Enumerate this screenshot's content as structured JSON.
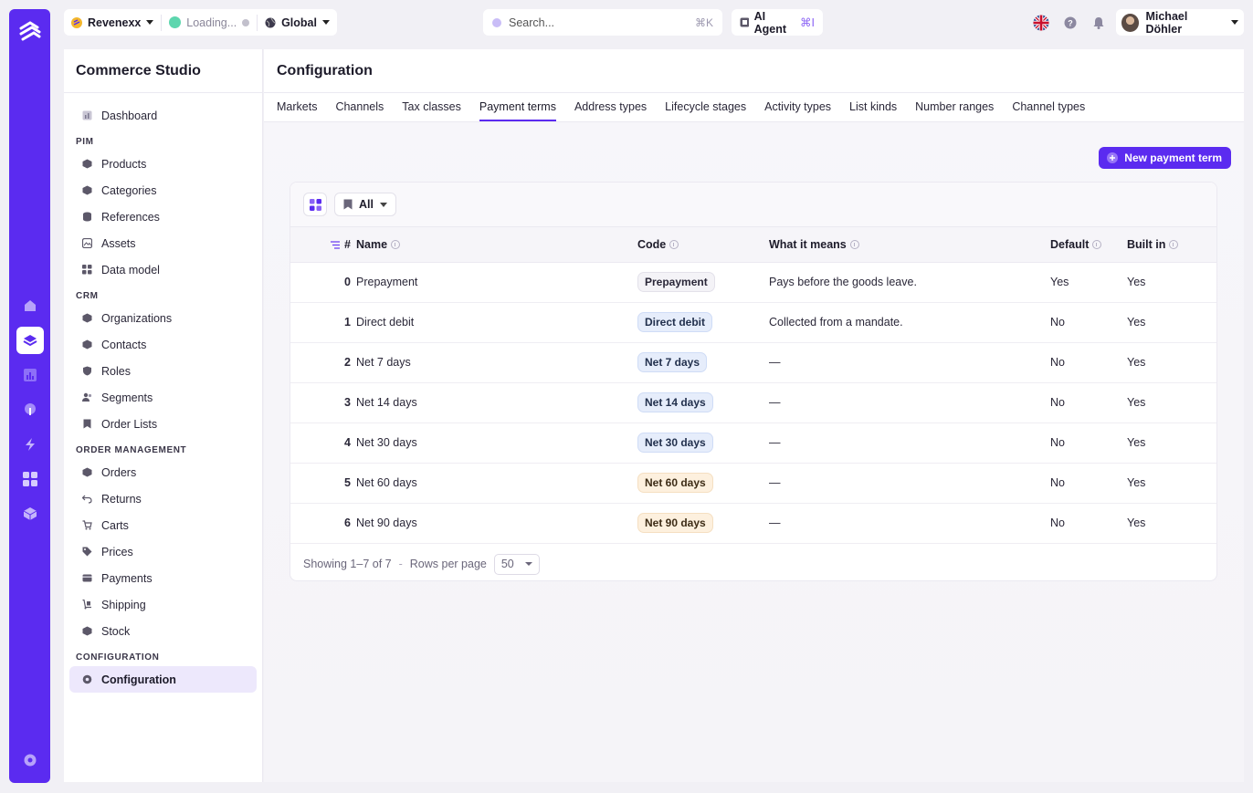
{
  "topbar": {
    "workspace": "Revenexx",
    "status": "Loading...",
    "region": "Global",
    "search_placeholder": "Search...",
    "search_shortcut": "⌘K",
    "agent_label": "AI Agent",
    "agent_shortcut": "⌘I",
    "user_name": "Michael Döhler"
  },
  "sidebar": {
    "title": "Commerce Studio",
    "dashboard": "Dashboard",
    "sections": [
      {
        "title": "PIM",
        "items": [
          "Products",
          "Categories",
          "References",
          "Assets",
          "Data model"
        ]
      },
      {
        "title": "CRM",
        "items": [
          "Organizations",
          "Contacts",
          "Roles",
          "Segments",
          "Order Lists"
        ]
      },
      {
        "title": "ORDER MANAGEMENT",
        "items": [
          "Orders",
          "Returns",
          "Carts",
          "Prices",
          "Payments",
          "Shipping",
          "Stock"
        ]
      },
      {
        "title": "CONFIGURATION",
        "items": [
          "Configuration"
        ]
      }
    ]
  },
  "page": {
    "title": "Configuration",
    "tabs": [
      "Markets",
      "Channels",
      "Tax classes",
      "Payment terms",
      "Address types",
      "Lifecycle stages",
      "Activity types",
      "List kinds",
      "Number ranges",
      "Channel types"
    ],
    "active_tab": "Payment terms",
    "new_button": "New payment term",
    "filter_label": "All"
  },
  "table": {
    "columns": {
      "index": "#",
      "name": "Name",
      "code": "Code",
      "meaning": "What it means",
      "default": "Default",
      "builtin": "Built in"
    },
    "rows": [
      {
        "index": "0",
        "name": "Prepayment",
        "code": "Prepayment",
        "code_color": "gray",
        "meaning": "Pays before the goods leave.",
        "default": "Yes",
        "builtin": "Yes"
      },
      {
        "index": "1",
        "name": "Direct debit",
        "code": "Direct debit",
        "code_color": "blue",
        "meaning": "Collected from a mandate.",
        "default": "No",
        "builtin": "Yes"
      },
      {
        "index": "2",
        "name": "Net 7 days",
        "code": "Net 7 days",
        "code_color": "blue",
        "meaning": "—",
        "default": "No",
        "builtin": "Yes"
      },
      {
        "index": "3",
        "name": "Net 14 days",
        "code": "Net 14 days",
        "code_color": "blue",
        "meaning": "—",
        "default": "No",
        "builtin": "Yes"
      },
      {
        "index": "4",
        "name": "Net 30 days",
        "code": "Net 30 days",
        "code_color": "blue",
        "meaning": "—",
        "default": "No",
        "builtin": "Yes"
      },
      {
        "index": "5",
        "name": "Net 60 days",
        "code": "Net 60 days",
        "code_color": "orange",
        "meaning": "—",
        "default": "No",
        "builtin": "Yes"
      },
      {
        "index": "6",
        "name": "Net 90 days",
        "code": "Net 90 days",
        "code_color": "orange",
        "meaning": "—",
        "default": "No",
        "builtin": "Yes"
      }
    ]
  },
  "pager": {
    "showing": "Showing 1–7 of 7",
    "separator": "-",
    "rows_label": "Rows per page",
    "rows_value": "50"
  },
  "colors": {
    "accent": "#5b2bf0"
  }
}
